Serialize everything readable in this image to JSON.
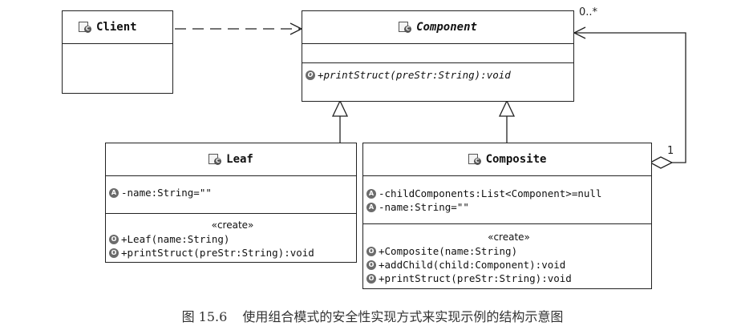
{
  "classes": {
    "client": {
      "name": "Client"
    },
    "component": {
      "name": "Component",
      "operations": [
        {
          "visibility": "public",
          "text": "+printStruct(preStr:String):void"
        }
      ]
    },
    "leaf": {
      "name": "Leaf",
      "attributes": [
        {
          "visibility": "private",
          "text": "-name:String=\"\""
        }
      ],
      "stereotype": "«create»",
      "operations": [
        {
          "visibility": "public",
          "text": "+Leaf(name:String)"
        },
        {
          "visibility": "public",
          "text": "+printStruct(preStr:String):void"
        }
      ]
    },
    "composite": {
      "name": "Composite",
      "attributes": [
        {
          "visibility": "private",
          "text": "-childComponents:List<Component>=null"
        },
        {
          "visibility": "private",
          "text": "-name:String=\"\""
        }
      ],
      "stereotype": "«create»",
      "operations": [
        {
          "visibility": "public",
          "text": "+Composite(name:String)"
        },
        {
          "visibility": "public",
          "text": "+addChild(child:Component):void"
        },
        {
          "visibility": "public",
          "text": "+printStruct(preStr:String):void"
        }
      ]
    }
  },
  "associations": {
    "aggregation_target_multiplicity": "0..*",
    "aggregation_source_multiplicity": "1"
  },
  "icons": {
    "class_icon": "class-icon",
    "visibility_public": "public-method-icon",
    "visibility_private": "private-field-icon"
  },
  "caption": {
    "number": "图 15.6",
    "text": "使用组合模式的安全性实现方式来实现示例的结构示意图"
  }
}
